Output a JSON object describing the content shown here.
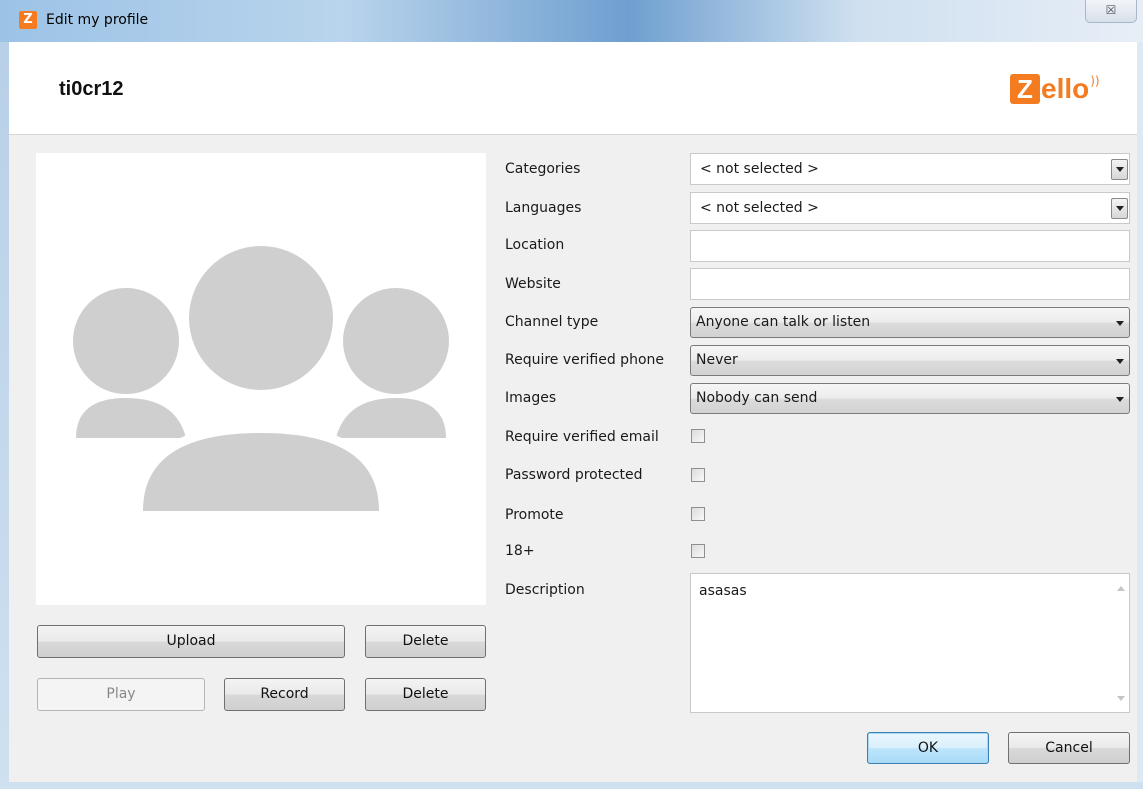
{
  "window": {
    "title": "Edit my profile",
    "app_icon": "zello-app-icon",
    "close_glyph": "☒"
  },
  "header": {
    "username": "ti0cr12",
    "logo_letter": "Z",
    "logo_rest": "ello",
    "logo_color": "#f47b20"
  },
  "avatar": {
    "icon": "group-placeholder-icon"
  },
  "buttons": {
    "upload": "Upload",
    "delete_picture": "Delete",
    "play": "Play",
    "record": "Record",
    "delete_voice": "Delete",
    "ok": "OK",
    "cancel": "Cancel"
  },
  "form": {
    "categories_label": "Categories",
    "categories_value": "< not selected >",
    "languages_label": "Languages",
    "languages_value": "< not selected >",
    "location_label": "Location",
    "location_value": "",
    "website_label": "Website",
    "website_value": "",
    "channel_type_label": "Channel type",
    "channel_type_value": "Anyone can talk or listen",
    "require_phone_label": "Require verified phone",
    "require_phone_value": "Never",
    "images_label": "Images",
    "images_value": "Nobody can send",
    "require_email_label": "Require verified email",
    "require_email_checked": false,
    "password_label": "Password protected",
    "password_checked": false,
    "promote_label": "Promote",
    "promote_checked": false,
    "adult_label": "18+",
    "adult_checked": false,
    "description_label": "Description",
    "description_value": "asasas"
  }
}
